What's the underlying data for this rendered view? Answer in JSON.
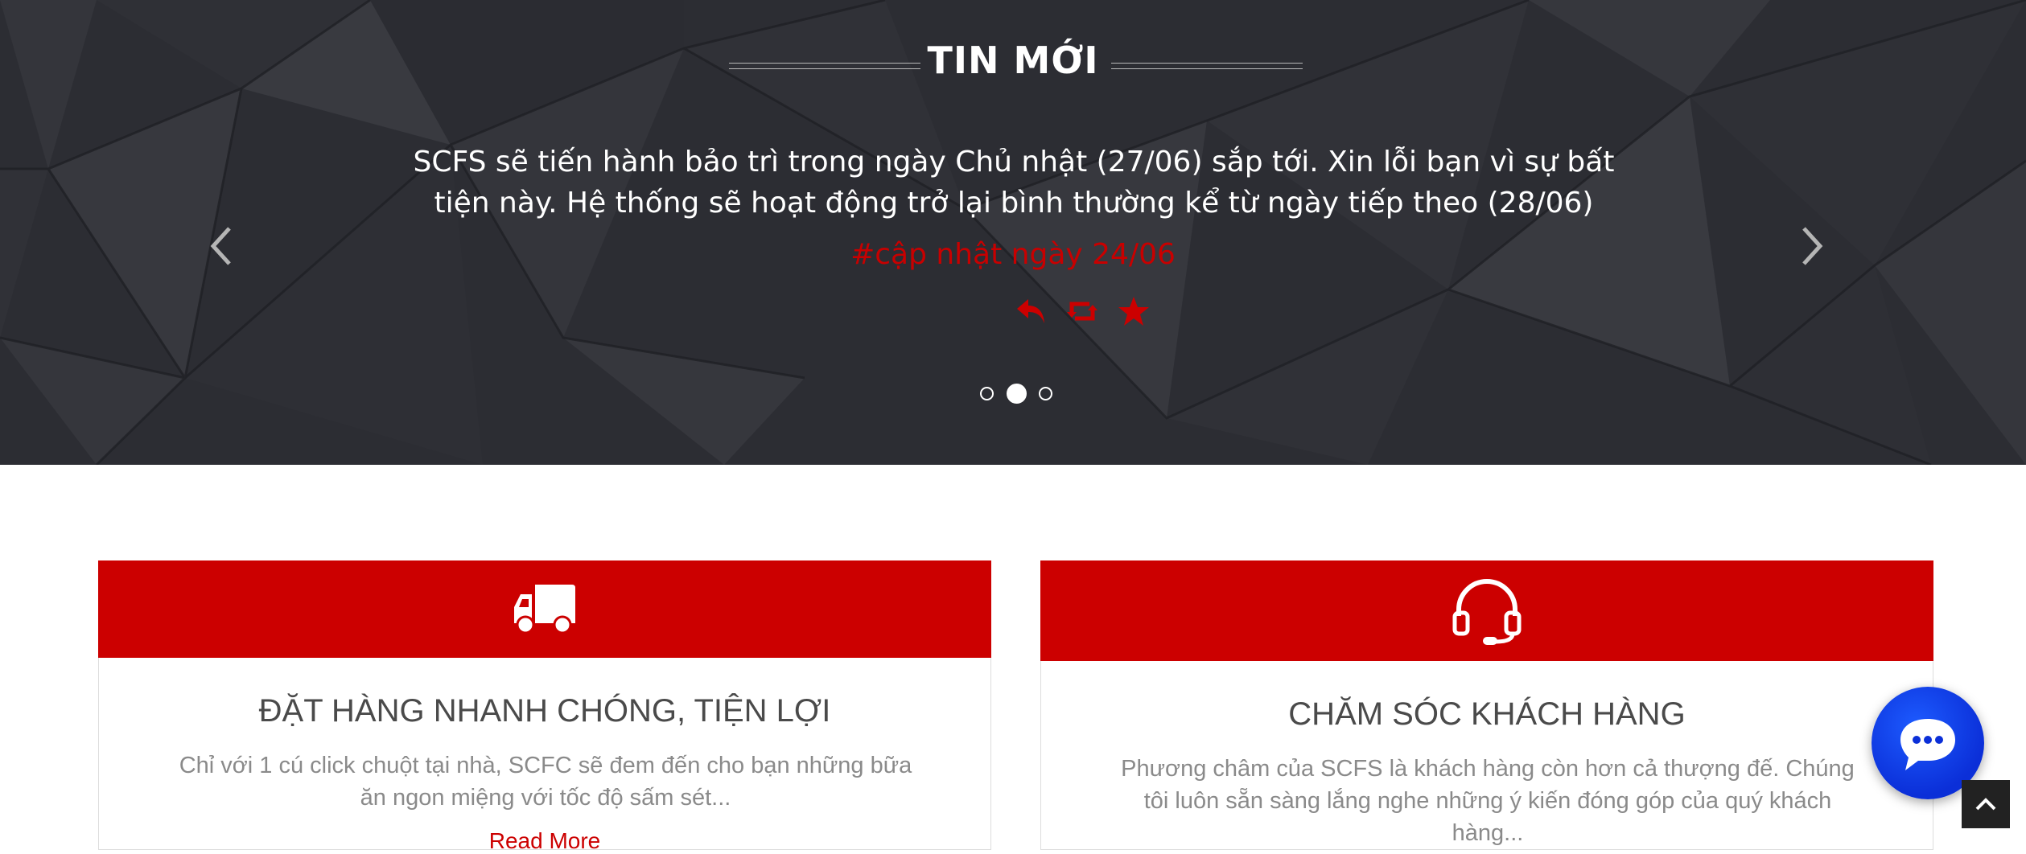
{
  "news": {
    "heading": "TIN MỚI",
    "text": "SCFS sẽ tiến hành bảo trì trong ngày Chủ nhật (27/06) sắp tới. Xin lỗi bạn vì sự bất tiện này. Hệ thống sẽ hoạt động trở lại bình thường kể từ ngày tiếp theo (28/06)",
    "tag": "#cập nhật ngày 24/06",
    "actions": [
      "reply-icon",
      "retweet-icon",
      "star-icon"
    ],
    "active_slide": 2,
    "slide_count": 3
  },
  "cards": [
    {
      "icon": "truck-icon",
      "title": "ĐẶT HÀNG NHANH CHÓNG, TIỆN LỢI",
      "text": "Chỉ với 1 cú click chuột tại nhà, SCFC sẽ đem đến cho bạn những bữa ăn ngon miệng với tốc độ sấm sét...",
      "link": "Read More"
    },
    {
      "icon": "headset-icon",
      "title": "CHĂM SÓC KHÁCH HÀNG",
      "text": "Phương châm của SCFS là khách hàng còn hơn cả thượng đế. Chúng tôi luôn sẵn sàng lắng nghe những ý kiến đóng góp của quý khách hàng..."
    }
  ],
  "widgets": {
    "chat_icon": "chat-bubble-icon",
    "top_icon": "chevron-up-icon"
  },
  "colors": {
    "accent": "#cc0000",
    "hero_bg": "#2c2d33",
    "chat": "#0b2fd8"
  }
}
